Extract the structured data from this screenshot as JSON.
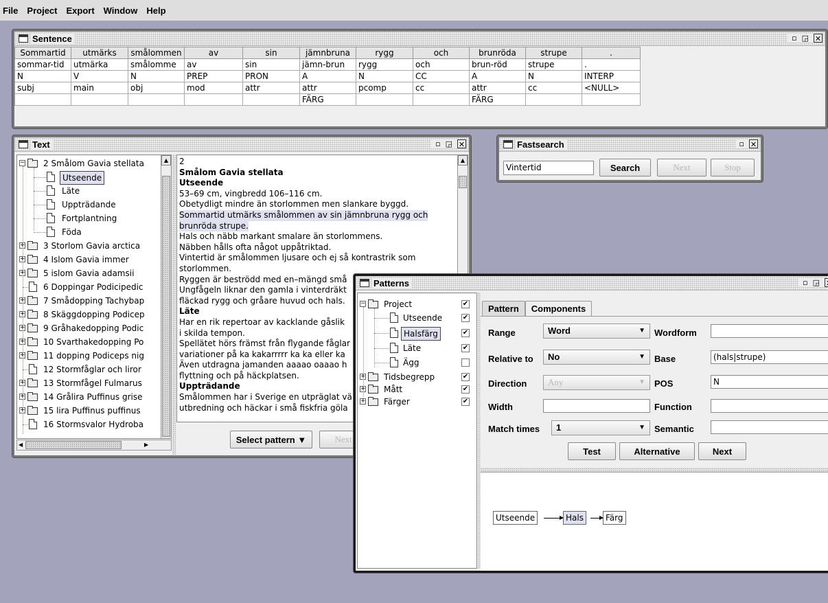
{
  "menu": [
    "File",
    "Project",
    "Export",
    "Window",
    "Help"
  ],
  "sentence": {
    "title": "Sentence",
    "headers": [
      "Sommartid",
      "utmärks",
      "smålommen",
      "av",
      "sin",
      "jämnbruna",
      "rygg",
      "och",
      "brunröda",
      "strupe",
      "."
    ],
    "rows": [
      [
        "sommar-tid",
        "utmärka",
        "smålomme",
        "av",
        "sin",
        "jämn-brun",
        "rygg",
        "och",
        "brun-röd",
        "strupe",
        "."
      ],
      [
        "N",
        "V",
        "N",
        "PREP",
        "PRON",
        "A",
        "N",
        "CC",
        "A",
        "N",
        "INTERP"
      ],
      [
        "subj",
        "main",
        "obj",
        "mod",
        "attr",
        "attr",
        "pcomp",
        "cc",
        "attr",
        "cc",
        "<NULL>"
      ],
      [
        "",
        "",
        "",
        "",
        "",
        "FÄRG",
        "",
        "",
        "FÄRG",
        "",
        ""
      ]
    ]
  },
  "text_window": {
    "title": "Text",
    "tree": [
      {
        "label": "2 Smålom Gavia stellata",
        "expander": "−",
        "type": "folder",
        "level": 0
      },
      {
        "label": "Utseende",
        "type": "doc",
        "level": 1,
        "selected": true
      },
      {
        "label": "Läte",
        "type": "doc",
        "level": 1
      },
      {
        "label": "Uppträdande",
        "type": "doc",
        "level": 1
      },
      {
        "label": "Fortplantning",
        "type": "doc",
        "level": 1
      },
      {
        "label": "Föda",
        "type": "doc",
        "level": 1
      },
      {
        "label": "3 Storlom Gavia arctica",
        "expander": "+",
        "type": "folder",
        "level": 0
      },
      {
        "label": "4 Islom Gavia immer",
        "expander": "+",
        "type": "folder",
        "level": 0
      },
      {
        "label": "5 islom Gavia adamsii",
        "expander": "+",
        "type": "folder",
        "level": 0
      },
      {
        "label": "6 Doppingar Podicipedic",
        "type": "doc",
        "level": 0
      },
      {
        "label": "7 Smådopping Tachybap",
        "expander": "+",
        "type": "folder",
        "level": 0
      },
      {
        "label": "8 Skäggdopping Podicep",
        "expander": "+",
        "type": "folder",
        "level": 0
      },
      {
        "label": "9 Gråhakedopping Podic",
        "expander": "+",
        "type": "folder",
        "level": 0
      },
      {
        "label": "10 Svarthakedopping Po",
        "expander": "+",
        "type": "folder",
        "level": 0
      },
      {
        "label": "11 dopping Podiceps nig",
        "expander": "+",
        "type": "folder",
        "level": 0
      },
      {
        "label": "12 Stormfåglar och liror",
        "type": "doc",
        "level": 0
      },
      {
        "label": "13 Stormfågel Fulmarus",
        "expander": "+",
        "type": "folder",
        "level": 0
      },
      {
        "label": "14 Grålira Puffinus grise",
        "expander": "+",
        "type": "folder",
        "level": 0
      },
      {
        "label": "15 lira Puffinus puffinus",
        "expander": "+",
        "type": "folder",
        "level": 0
      },
      {
        "label": "16 Stormsvalor Hydroba",
        "type": "doc",
        "level": 0
      }
    ],
    "content": [
      {
        "t": "2",
        "style": ""
      },
      {
        "t": "Smålom Gavia stellata",
        "style": "b"
      },
      {
        "t": "Utseende",
        "style": "b"
      },
      {
        "t": "53–69 cm, vingbredd 106–116 cm.",
        "style": ""
      },
      {
        "t": "Obetydligt mindre än storlommen men slankare byggd.",
        "style": ""
      },
      {
        "t": "Sommartid utmärks smålommen av sin jämnbruna rygg och",
        "style": "hl"
      },
      {
        "t": "brunröda strupe.",
        "style": "hl"
      },
      {
        "t": "Hals och näbb markant smalare än storlommens.",
        "style": ""
      },
      {
        "t": "Näbben hålls ofta något uppåtriktad.",
        "style": ""
      },
      {
        "t": "Vintertid är smålommen ljusare och ej så kontrastrik som",
        "style": ""
      },
      {
        "t": "storlommen.",
        "style": ""
      },
      {
        "t": "Ryggen är beströdd med en–mängd små",
        "style": ""
      },
      {
        "t": "Ungfågeln liknar den gamla i vinterdräkt",
        "style": ""
      },
      {
        "t": "fläckad rygg och gråare huvud och hals.",
        "style": ""
      },
      {
        "t": "Läte",
        "style": "b"
      },
      {
        "t": "Har en rik repertoar av kacklande gåslik",
        "style": ""
      },
      {
        "t": "i skilda tempon.",
        "style": ""
      },
      {
        "t": "Spellätet hörs främst från flygande fåglar",
        "style": ""
      },
      {
        "t": "variationer på ka kakarrrrr ka ka eller ka",
        "style": ""
      },
      {
        "t": "Även utdragna jamanden aaaao oaaao h",
        "style": ""
      },
      {
        "t": "flyttning och på häckplatsen.",
        "style": ""
      },
      {
        "t": "Uppträdande",
        "style": "b"
      },
      {
        "t": "Smålommen har i Sverige en utpräglat vä",
        "style": ""
      },
      {
        "t": "utbredning och häckar i små fiskfria göla",
        "style": ""
      }
    ],
    "select_pattern": "Select pattern ▼",
    "next": "Next"
  },
  "fastsearch": {
    "title": "Fastsearch",
    "query": "Vintertid",
    "search": "Search",
    "next": "Next",
    "stop": "Stop"
  },
  "patterns": {
    "title": "Patterns",
    "tree": [
      {
        "label": "Project",
        "expander": "−",
        "type": "folder",
        "level": 0,
        "checked": true
      },
      {
        "label": "Utseende",
        "type": "doc",
        "level": 1,
        "checked": true
      },
      {
        "label": "Halsfärg",
        "type": "doc",
        "level": 1,
        "checked": true,
        "selected": true
      },
      {
        "label": "Läte",
        "type": "doc",
        "level": 1,
        "checked": true
      },
      {
        "label": "Ägg",
        "type": "doc",
        "level": 1,
        "checked": false
      },
      {
        "label": "Tidsbegrepp",
        "expander": "+",
        "type": "folder",
        "level": 0,
        "checked": true
      },
      {
        "label": "Mått",
        "expander": "+",
        "type": "folder",
        "level": 0,
        "checked": true
      },
      {
        "label": "Färger",
        "expander": "+",
        "type": "folder",
        "level": 0,
        "checked": true
      }
    ],
    "tabs": [
      "Pattern",
      "Components"
    ],
    "labels": {
      "range": "Range",
      "relative": "Relative to",
      "direction": "Direction",
      "width": "Width",
      "match": "Match times",
      "wordform": "Wordform",
      "base": "Base",
      "pos": "POS",
      "function": "Function",
      "semantic": "Semantic"
    },
    "values": {
      "range": "Word",
      "relative": "No",
      "direction": "Any",
      "width": "",
      "match": "1",
      "wordform": "",
      "base": "(hals|strupe)",
      "pos": "N",
      "function": "",
      "semantic": ""
    },
    "buttons": {
      "test": "Test",
      "alternative": "Alternative",
      "next": "Next"
    },
    "graph": [
      "Utseende",
      "Hals",
      "Färg"
    ]
  }
}
